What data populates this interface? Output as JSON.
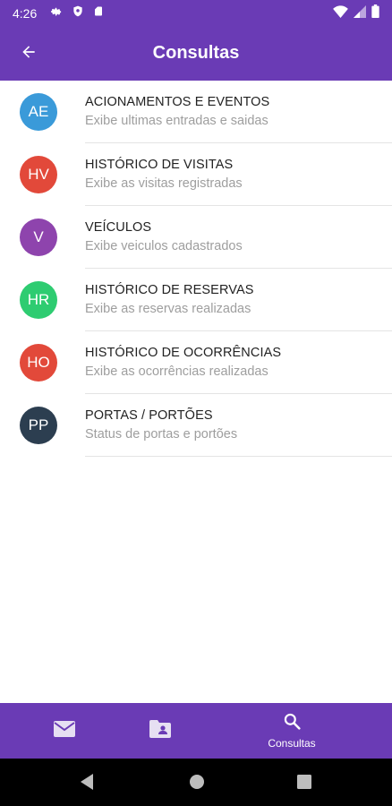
{
  "status_bar": {
    "time": "4:26",
    "left_icons": [
      "gear-icon",
      "shield-icon",
      "sd-card-icon"
    ],
    "right_icons": [
      "wifi-icon",
      "signal-icon",
      "battery-icon"
    ]
  },
  "app_bar": {
    "title": "Consultas",
    "back_icon": "arrow-back-icon"
  },
  "items": [
    {
      "initials": "AE",
      "title": "ACIONAMENTOS E EVENTOS",
      "subtitle": "Exibe ultimas entradas e saidas",
      "color": "#3a9ad9"
    },
    {
      "initials": "HV",
      "title": "HISTÓRICO DE VISITAS",
      "subtitle": "Exibe as visitas registradas",
      "color": "#e2493a"
    },
    {
      "initials": "V",
      "title": "VEÍCULOS",
      "subtitle": "Exibe veiculos cadastrados",
      "color": "#8e44ad"
    },
    {
      "initials": "HR",
      "title": "HISTÓRICO DE RESERVAS",
      "subtitle": "Exibe as reservas realizadas",
      "color": "#2ecc71"
    },
    {
      "initials": "HO",
      "title": "HISTÓRICO DE OCORRÊNCIAS",
      "subtitle": "Exibe as ocorrências realizadas",
      "color": "#e2493a"
    },
    {
      "initials": "PP",
      "title": "PORTAS / PORTÕES",
      "subtitle": "Status de portas e portões",
      "color": "#2c3e50"
    }
  ],
  "bottom_nav": {
    "items": [
      {
        "icon": "mail-icon",
        "label": ""
      },
      {
        "icon": "contact-folder-icon",
        "label": ""
      },
      {
        "icon": "search-icon",
        "label": "Consultas"
      }
    ]
  },
  "system_nav": {
    "buttons": [
      "back-triangle-icon",
      "home-circle-icon",
      "recents-square-icon"
    ]
  },
  "colors": {
    "primary": "#6a3bb5",
    "divider": "#e4e4e4",
    "subtitle_text": "#9e9e9e"
  }
}
